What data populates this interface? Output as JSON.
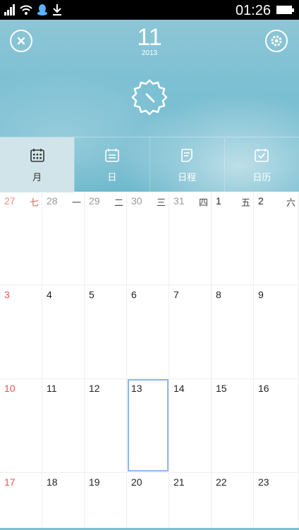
{
  "status_bar": {
    "time": "01:26",
    "icons": [
      "signal-icon",
      "wifi-icon",
      "qq-icon",
      "download-icon",
      "battery-icon"
    ]
  },
  "header": {
    "day": "11",
    "year": "2013",
    "weather_icon": "sun-icon"
  },
  "tabs": [
    {
      "label": "月",
      "icon": "calendar-month-icon",
      "active": true
    },
    {
      "label": "日",
      "icon": "calendar-day-icon",
      "active": false
    },
    {
      "label": "日程",
      "icon": "schedule-icon",
      "active": false
    },
    {
      "label": "日历",
      "icon": "calendar-check-icon",
      "active": false
    }
  ],
  "calendar": {
    "weekdays": [
      "七",
      "一",
      "二",
      "三",
      "四",
      "五",
      "六"
    ],
    "weeks": [
      [
        "27",
        "28",
        "29",
        "30",
        "31",
        "1",
        "2"
      ],
      [
        "3",
        "4",
        "5",
        "6",
        "7",
        "8",
        "9"
      ],
      [
        "10",
        "11",
        "12",
        "13",
        "14",
        "15",
        "16"
      ],
      [
        "17",
        "18",
        "19",
        "20",
        "21",
        "22",
        "23"
      ]
    ],
    "selected": "13",
    "colors": {
      "sunday": "#e85454",
      "selection": "#8fb6ec",
      "accent": "#7cc0d3"
    }
  }
}
